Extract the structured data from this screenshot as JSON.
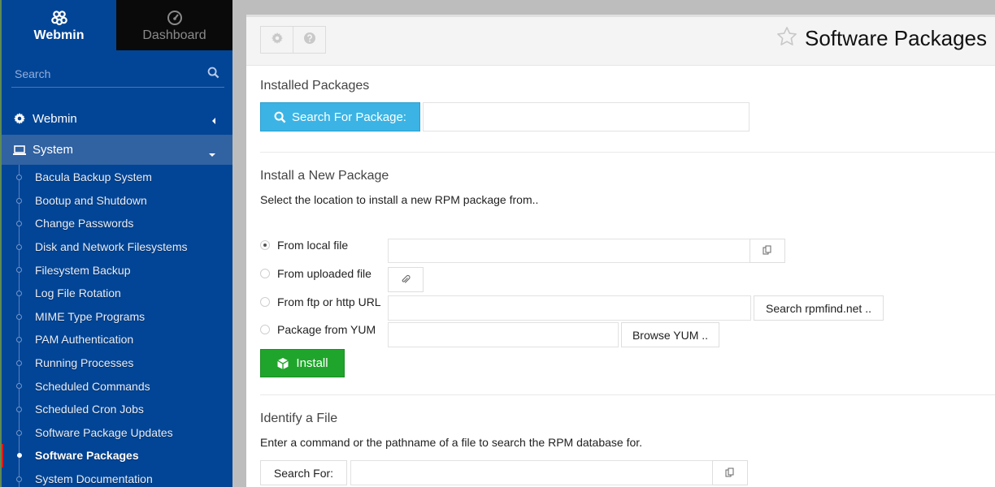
{
  "sidebar": {
    "tabs": [
      {
        "label": "Webmin",
        "icon": "webmin-logo-icon",
        "active": true
      },
      {
        "label": "Dashboard",
        "icon": "dashboard-gauge-icon",
        "active": false
      }
    ],
    "search": {
      "placeholder": "Search",
      "value": ""
    },
    "categories": [
      {
        "label": "Webmin",
        "icon": "gear-icon",
        "expanded": false
      },
      {
        "label": "System",
        "icon": "laptop-icon",
        "expanded": true
      }
    ],
    "system_items": [
      {
        "label": "Bacula Backup System"
      },
      {
        "label": "Bootup and Shutdown"
      },
      {
        "label": "Change Passwords"
      },
      {
        "label": "Disk and Network Filesystems"
      },
      {
        "label": "Filesystem Backup"
      },
      {
        "label": "Log File Rotation"
      },
      {
        "label": "MIME Type Programs"
      },
      {
        "label": "PAM Authentication"
      },
      {
        "label": "Running Processes"
      },
      {
        "label": "Scheduled Commands"
      },
      {
        "label": "Scheduled Cron Jobs"
      },
      {
        "label": "Software Package Updates"
      },
      {
        "label": "Software Packages",
        "active": true
      },
      {
        "label": "System Documentation"
      }
    ],
    "active_color": "#e81818"
  },
  "header": {
    "title": "Software Packages",
    "buttons": [
      "module-config",
      "help"
    ]
  },
  "installed": {
    "title": "Installed Packages",
    "search_button": "Search For Package:",
    "search_value": ""
  },
  "install": {
    "title": "Install a New Package",
    "description": "Select the location to install a new RPM package from..",
    "options": [
      {
        "label": "From local file",
        "checked": true,
        "value": ""
      },
      {
        "label": "From uploaded file",
        "checked": false
      },
      {
        "label": "From ftp or http URL",
        "checked": false,
        "value": "",
        "button": "Search rpmfind.net .."
      },
      {
        "label": "Package from YUM",
        "checked": false,
        "value": "",
        "button": "Browse YUM .."
      }
    ],
    "install_button": "Install"
  },
  "identify": {
    "title": "Identify a File",
    "description": "Enter a command or the pathname of a file to search the RPM database for.",
    "search_button": "Search For:",
    "search_value": ""
  },
  "colors": {
    "sidebar_bg": "#024596",
    "search_button_bg": "#3bb4e5",
    "install_button_bg": "#1fa52b"
  }
}
